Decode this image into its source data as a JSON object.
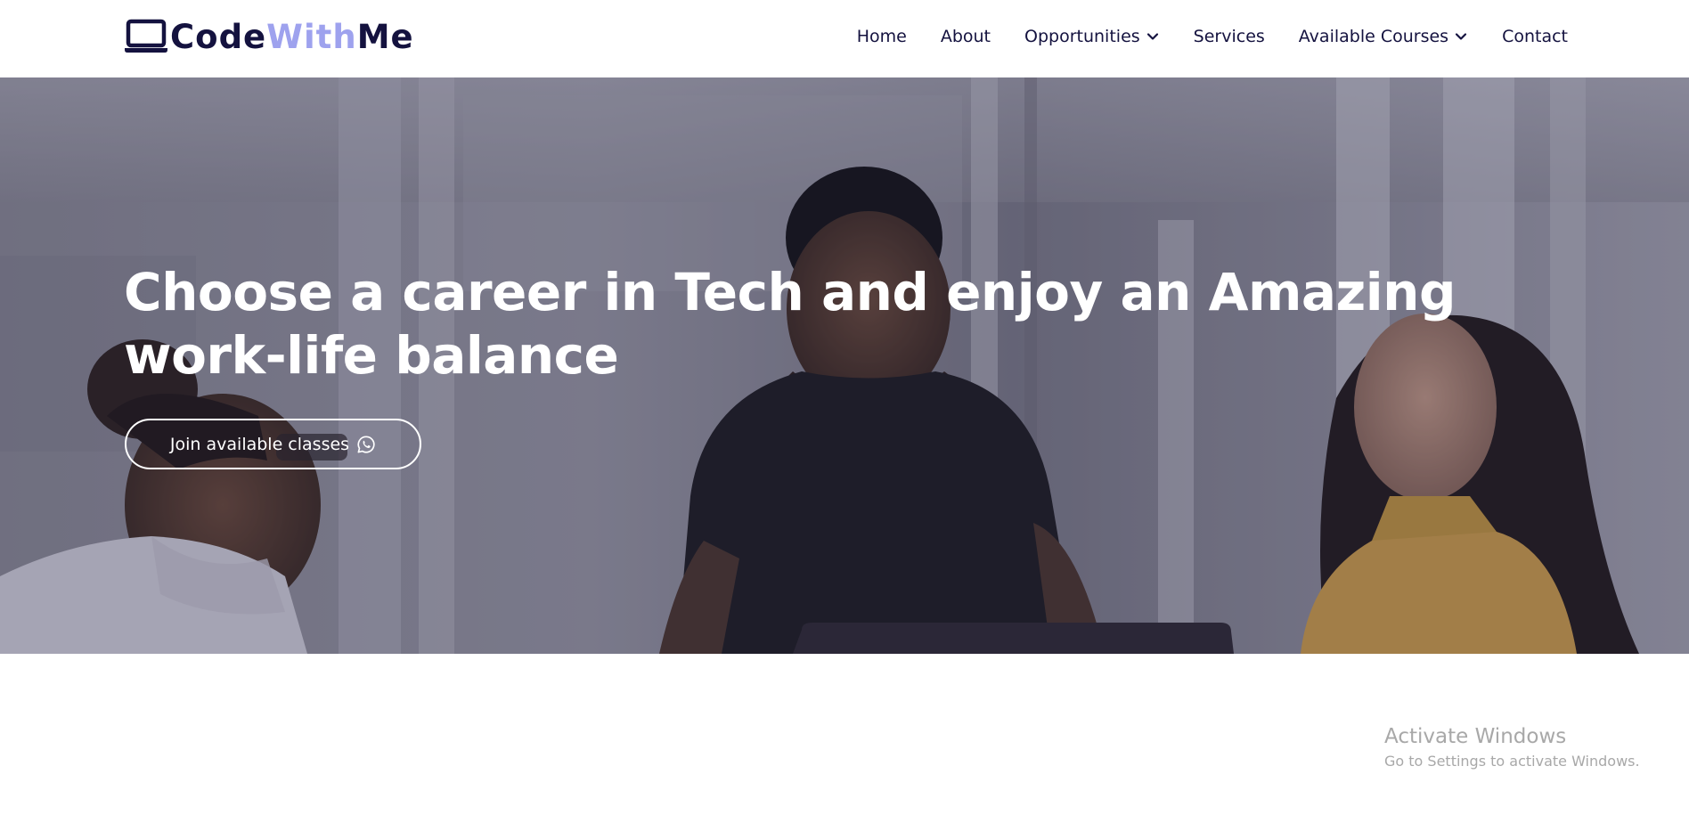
{
  "brand": {
    "part1": "Code",
    "part2": "With",
    "part3": "Me",
    "icon": "laptop-icon",
    "colors": {
      "dark": "#14123f",
      "accent": "#9ea2ee"
    }
  },
  "nav": {
    "items": [
      {
        "label": "Home",
        "dropdown": false
      },
      {
        "label": "About",
        "dropdown": false
      },
      {
        "label": "Opportunities",
        "dropdown": true
      },
      {
        "label": "Services",
        "dropdown": false
      },
      {
        "label": "Available Courses",
        "dropdown": true
      },
      {
        "label": "Contact",
        "dropdown": false
      }
    ],
    "dropdown_icon": "chevron-down-icon"
  },
  "hero": {
    "title": "Choose a career in Tech and enjoy an Amazing work-life balance",
    "cta_label": "Join available classes",
    "cta_icon": "whatsapp-icon",
    "background": "photo of three people working at a laptop in an office"
  },
  "os_watermark": {
    "line1": "Activate Windows",
    "line2": "Go to Settings to activate Windows."
  }
}
